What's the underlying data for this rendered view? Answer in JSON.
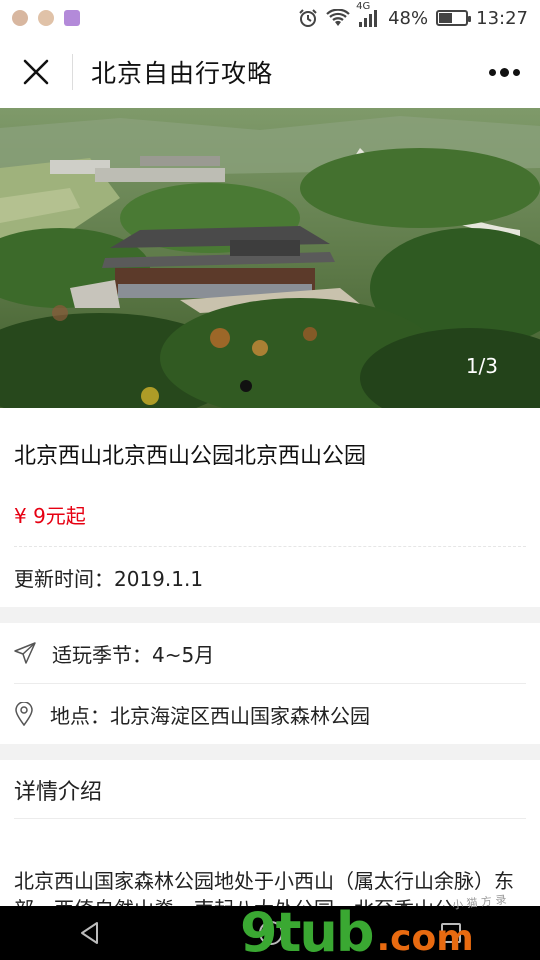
{
  "status_bar": {
    "network": "4G",
    "battery": "48%",
    "battery_level": 0.48,
    "time": "13:27"
  },
  "nav": {
    "title": "北京自由行攻略",
    "close_icon": "close-icon",
    "more_icon": "more-icon"
  },
  "hero": {
    "counter": "1/3",
    "current_index": 1,
    "total": 3
  },
  "spot": {
    "title": "北京西山北京西山公园北京西山公园",
    "price": "¥ 9元起",
    "update_label": "更新时间：",
    "update_value": "2019.1.1"
  },
  "info": {
    "season_label": "适玩季节：",
    "season_value": "4~5月",
    "location_label": "地点：",
    "location_value": "北京海淀区西山国家森林公园"
  },
  "detail": {
    "title": "详情介绍",
    "text": "北京西山国家森林公园地处于小西山（属太行山余脉）东部，西倚自然山脊，南起八大处公园，北至香山公"
  },
  "watermark": {
    "main": "9tub",
    "suffix": ".com",
    "small": "小 猫 方 录"
  },
  "colors": {
    "price": "#e60012",
    "watermark_green": "#3aa832",
    "watermark_orange": "#e86a10"
  }
}
